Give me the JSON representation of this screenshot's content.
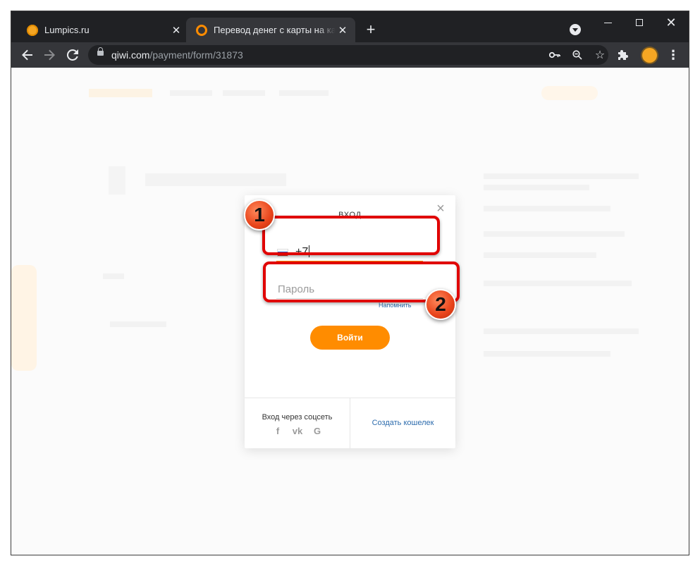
{
  "browser": {
    "tabs": [
      {
        "title": "Lumpics.ru",
        "active": false
      },
      {
        "title": "Перевод денег с карты на карту",
        "active": true
      }
    ],
    "url_host": "qiwi.com",
    "url_path": "/payment/form/31873"
  },
  "modal": {
    "title": "ВХОД",
    "phone_value": "+7",
    "password_placeholder": "Пароль",
    "remind_link": "Напомнить",
    "login_button": "Войти",
    "social_label": "Вход через соцсеть",
    "social_icons": [
      "facebook-icon",
      "vk-icon",
      "google-icon"
    ],
    "create_wallet_link": "Создать кошелек"
  },
  "annotations": {
    "badge_1": "1",
    "badge_2": "2",
    "color": "#e00000"
  },
  "colors": {
    "accent": "#ff8c00",
    "link": "#2d6cad"
  }
}
